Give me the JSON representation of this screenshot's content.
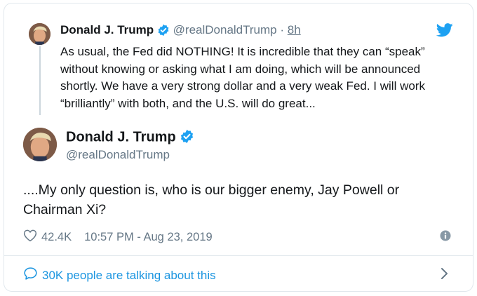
{
  "parent_tweet": {
    "author_name": "Donald J. Trump",
    "handle": "@realDonaldTrump",
    "separator": "·",
    "age": "8h",
    "text": "As usual, the Fed did NOTHING! It is incredible that they can “speak” without knowing or asking what I am doing, which will be announced shortly. We have a very strong dollar and a very weak Fed. I will work “brilliantly” with both, and the U.S. will do great..."
  },
  "main_tweet": {
    "author_name": "Donald J. Trump",
    "handle": "@realDonaldTrump",
    "text": "....My only question is, who is our bigger enemy, Jay Powell or Chairman Xi?",
    "likes": "42.4K",
    "timestamp": "10:57 PM - Aug 23, 2019"
  },
  "footer": {
    "talking_label": "30K people are talking about this"
  },
  "icons": {
    "verified": "verified-badge-icon",
    "twitter": "twitter-bird-icon",
    "like": "heart-icon",
    "info": "info-icon",
    "reply": "speech-bubble-icon",
    "chevron": "chevron-right-icon"
  },
  "colors": {
    "accent": "#1da1f2",
    "link": "#1b95e0",
    "muted": "#657786",
    "text": "#14171a",
    "border": "#e1e8ed"
  }
}
